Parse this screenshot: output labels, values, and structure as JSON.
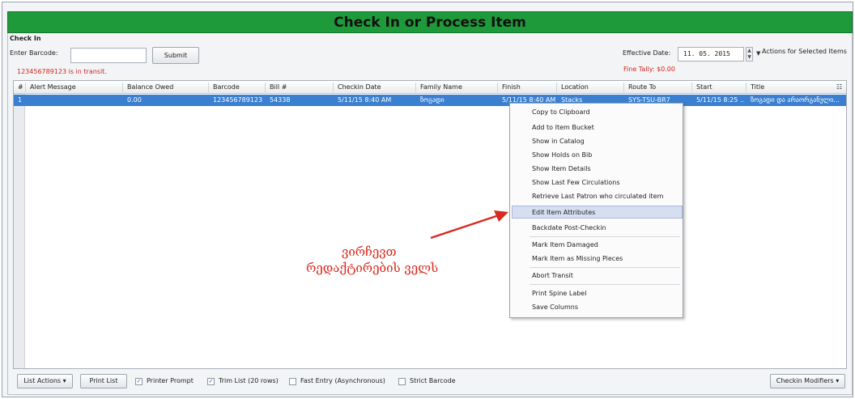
{
  "window": {
    "title": "Check In or Process Item"
  },
  "checkin": {
    "heading": "Check In",
    "barcode_label": "Enter Barcode:",
    "barcode_value": "",
    "submit_label": "Submit",
    "transit_message": "123456789123 is in transit."
  },
  "effective": {
    "label": "Effective Date:",
    "date_value": "11. 05.  2015",
    "actions_label": "Actions for Selected Items",
    "fine_tally": "Fine Tally: $0.00"
  },
  "grid": {
    "columns": [
      "#",
      "Alert Message",
      "Balance Owed",
      "Barcode",
      "Bill #",
      "Checkin Date",
      "Family Name",
      "Finish",
      "Location",
      "Route To",
      "Start",
      "Title"
    ],
    "rows": [
      {
        "num": "1",
        "alert": "",
        "balance": "0.00",
        "barcode": "123456789123",
        "bill": "54338",
        "checkin_date": "5/11/15 8:40 AM",
        "family": "ზოგადი",
        "finish": "5/11/15 8:40 AM",
        "location": "Stacks",
        "route_to": "SYS-TSU-BR7",
        "start": "5/11/15 8:25 ...",
        "title": "ზოგადი და არაორგანული..."
      }
    ]
  },
  "context_menu": {
    "items": [
      "Copy to Clipboard",
      "Add to Item Bucket",
      "Show in Catalog",
      "Show Holds on Bib",
      "Show Item Details",
      "Show Last Few Circulations",
      "Retrieve Last Patron who circulated item",
      "Edit Item Attributes",
      "Backdate Post-Checkin",
      "Mark Item Damaged",
      "Mark Item as Missing Pieces",
      "Abort Transit",
      "Print Spine Label",
      "Save Columns"
    ],
    "highlighted": "Edit Item Attributes"
  },
  "annotation": {
    "line1": "ვირჩევთ",
    "line2": "რედაქტირების ველს",
    "color": "#d82a1f"
  },
  "footer": {
    "list_actions": "List Actions",
    "print_list": "Print List",
    "printer_prompt": "Printer Prompt",
    "printer_prompt_checked": true,
    "trim_list": "Trim List (20 rows)",
    "trim_list_checked": true,
    "fast_entry": "Fast Entry (Asynchronous)",
    "fast_entry_checked": false,
    "strict_barcode": "Strict Barcode",
    "strict_barcode_checked": false,
    "checkin_modifiers": "Checkin Modifiers"
  },
  "colors": {
    "title_bar": "#1f9a3a",
    "selection": "#3a7fd0",
    "alert_text": "#d2241d"
  }
}
